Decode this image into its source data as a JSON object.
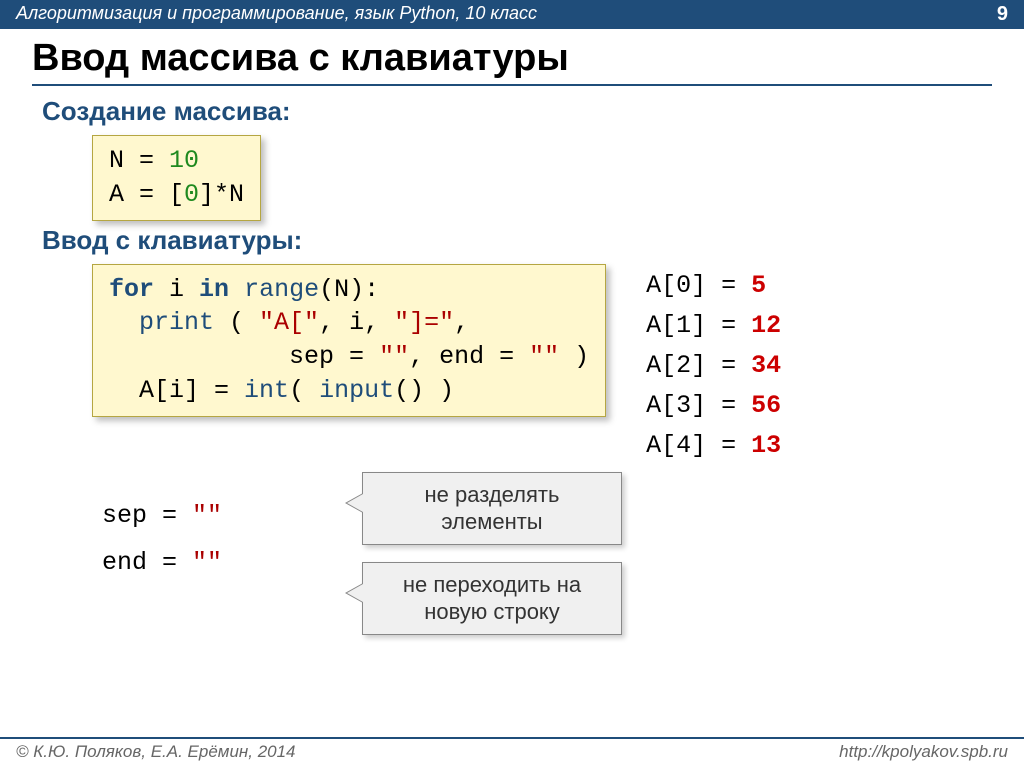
{
  "header": {
    "course": "Алгоритмизация и программирование, язык Python, 10 класс",
    "page": "9"
  },
  "title": "Ввод массива с клавиатуры",
  "sec1": "Создание массива:",
  "code1": {
    "l1a": "N",
    "l1b": " = ",
    "l1c": "10",
    "l2a": "A",
    "l2b": " = [",
    "l2c": "0",
    "l2d": "]*N"
  },
  "sec2": "Ввод с клавиатуры:",
  "code2": {
    "l1_for": "for",
    "l1_i": " i ",
    "l1_in": "in",
    "l1_sp": " ",
    "l1_range": "range",
    "l1_tail": "(N):",
    "l2_ind": "  ",
    "l2_print": "print",
    "l2_open": " ( ",
    "l2_s1": "\"A[\"",
    "l2_c1": ", i, ",
    "l2_s2": "\"]=\"",
    "l2_c2": ",",
    "l3_ind": "            ",
    "l3_sep": "sep",
    "l3_eq1": " = ",
    "l3_v1": "\"\"",
    "l3_c": ", ",
    "l3_end": "end",
    "l3_eq2": " = ",
    "l3_v2": "\"\"",
    "l3_close": " )",
    "l4_ind": "  ",
    "l4_a": "A[i]",
    "l4_eq": " = ",
    "l4_int": "int",
    "l4_open": "( ",
    "l4_input": "input",
    "l4_tail": "() )"
  },
  "outputs": [
    {
      "k": "A[0] =",
      "v": " 5"
    },
    {
      "k": "A[1] =",
      "v": " 12"
    },
    {
      "k": "A[2] =",
      "v": " 34"
    },
    {
      "k": "A[3] =",
      "v": " 56"
    },
    {
      "k": "A[4] =",
      "v": " 13"
    }
  ],
  "params": {
    "p1a": "sep",
    "p1b": " = ",
    "p1c": "\"\"",
    "p2a": "end",
    "p2b": " = ",
    "p2c": "\"\""
  },
  "call1_l1": "не разделять",
  "call1_l2": "элементы",
  "call2_l1": "не переходить на",
  "call2_l2": "новую строку",
  "footer": {
    "left": "© К.Ю. Поляков, Е.А. Ерёмин, 2014",
    "right": "http://kpolyakov.spb.ru"
  }
}
